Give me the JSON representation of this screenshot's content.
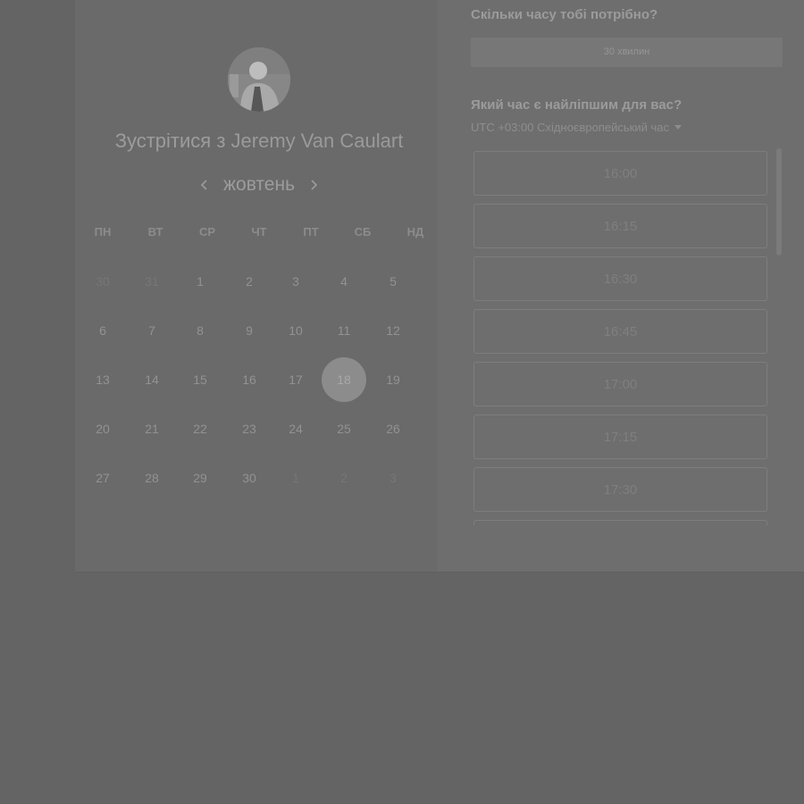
{
  "colors": {
    "background": "#646464",
    "panel": "#6a6a6a",
    "selected_day": "#8c8c8c"
  },
  "left": {
    "avatar_icon": "user-avatar",
    "title_prefix": "Зустрітися з",
    "host_name": "Jeremy Van Caulart",
    "month": "жовтень",
    "prev_icon": "chevron-left-icon",
    "next_icon": "chevron-right-icon",
    "weekdays": [
      "ПН",
      "ВТ",
      "СР",
      "ЧТ",
      "ПТ",
      "СБ",
      "НД"
    ],
    "days": [
      {
        "label": "30",
        "state": "muted"
      },
      {
        "label": "31",
        "state": "muted"
      },
      {
        "label": "1",
        "state": "normal"
      },
      {
        "label": "2",
        "state": "normal"
      },
      {
        "label": "3",
        "state": "normal"
      },
      {
        "label": "4",
        "state": "normal"
      },
      {
        "label": "5",
        "state": "normal"
      },
      {
        "label": "6",
        "state": "normal"
      },
      {
        "label": "7",
        "state": "normal"
      },
      {
        "label": "8",
        "state": "normal"
      },
      {
        "label": "9",
        "state": "normal"
      },
      {
        "label": "10",
        "state": "normal"
      },
      {
        "label": "11",
        "state": "normal"
      },
      {
        "label": "12",
        "state": "normal"
      },
      {
        "label": "13",
        "state": "normal"
      },
      {
        "label": "14",
        "state": "normal"
      },
      {
        "label": "15",
        "state": "normal"
      },
      {
        "label": "16",
        "state": "normal"
      },
      {
        "label": "17",
        "state": "normal"
      },
      {
        "label": "18",
        "state": "selected"
      },
      {
        "label": "19",
        "state": "normal"
      },
      {
        "label": "20",
        "state": "normal"
      },
      {
        "label": "21",
        "state": "normal"
      },
      {
        "label": "22",
        "state": "normal"
      },
      {
        "label": "23",
        "state": "normal"
      },
      {
        "label": "24",
        "state": "normal"
      },
      {
        "label": "25",
        "state": "normal"
      },
      {
        "label": "26",
        "state": "normal"
      },
      {
        "label": "27",
        "state": "normal"
      },
      {
        "label": "28",
        "state": "normal"
      },
      {
        "label": "29",
        "state": "normal"
      },
      {
        "label": "30",
        "state": "normal"
      },
      {
        "label": "1",
        "state": "muted"
      },
      {
        "label": "2",
        "state": "muted"
      },
      {
        "label": "3",
        "state": "muted"
      }
    ]
  },
  "right": {
    "duration_question": "Скільки часу тобі потрібно?",
    "duration_value": "30 хвилин",
    "time_question": "Який час є найліпшим для вас?",
    "timezone": "UTC +03:00 Східноєвропейський час",
    "timezone_icon": "caret-down-icon",
    "slots": [
      "16:00",
      "16:15",
      "16:30",
      "16:45",
      "17:00",
      "17:15",
      "17:30",
      ""
    ]
  }
}
